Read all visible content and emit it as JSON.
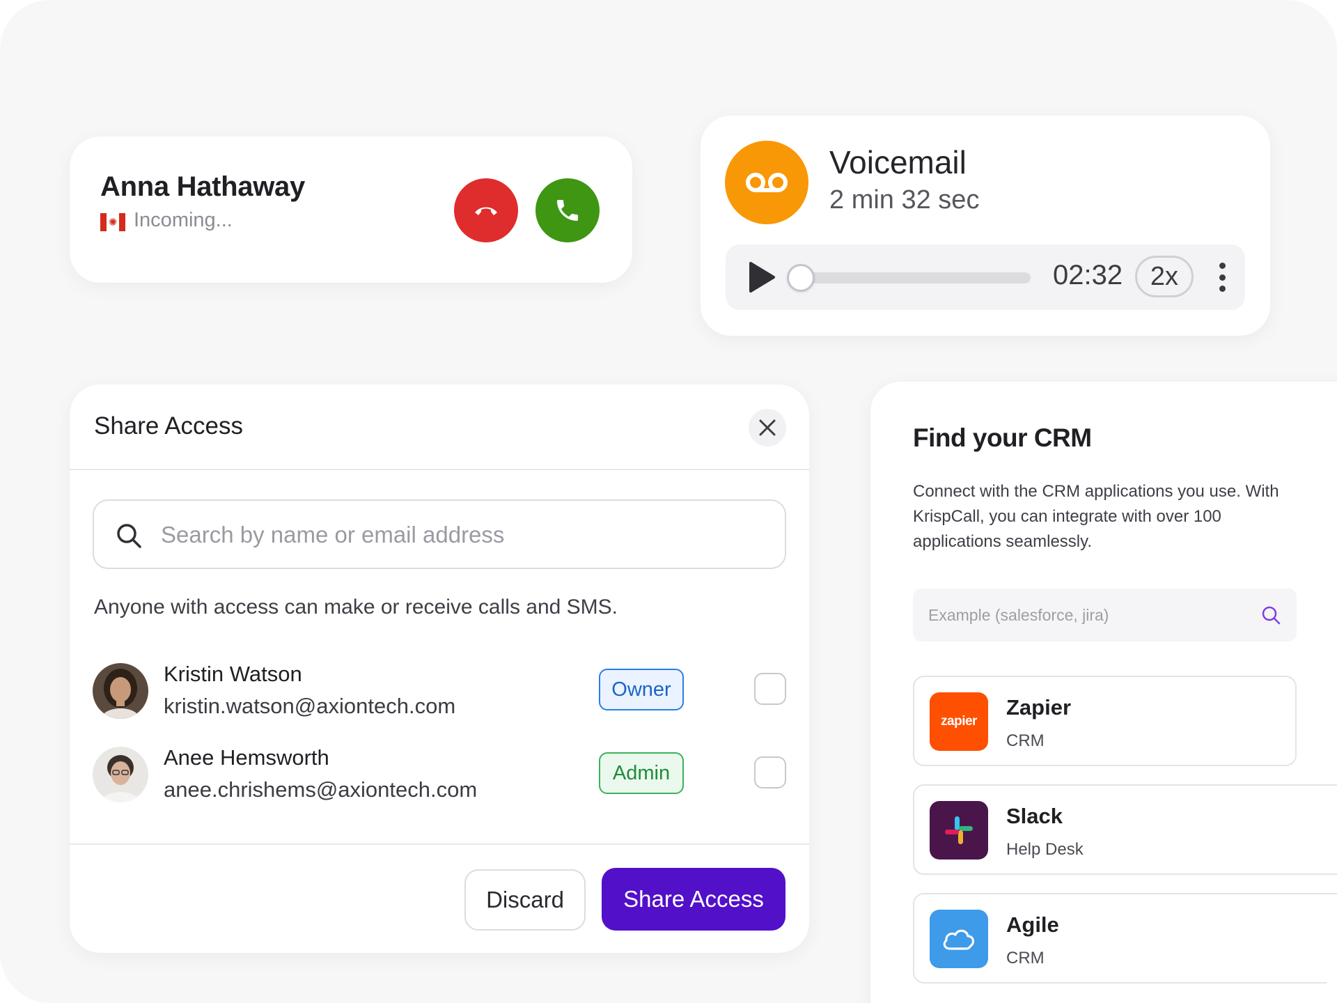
{
  "call": {
    "caller_name": "Anna Hathaway",
    "status": "Incoming...",
    "flag_icon": "canada-flag-icon",
    "decline_color": "#df2c2c",
    "accept_color": "#3e9612"
  },
  "voicemail": {
    "title": "Voicemail",
    "duration": "2 min 32 sec",
    "time": "02:32",
    "speed": "2x",
    "progress": 0,
    "accent": "#f99806"
  },
  "share": {
    "title": "Share Access",
    "search_placeholder": "Search by name or email address",
    "notice": "Anyone with access can make or receive calls and SMS.",
    "members": [
      {
        "name": "Kristin Watson",
        "email": "kristin.watson@axiontech.com",
        "role": "Owner",
        "checked": false
      },
      {
        "name": "Anee Hemsworth",
        "email": "anee.chrishems@axiontech.com",
        "role": "Admin",
        "checked": false
      }
    ],
    "discard_label": "Discard",
    "share_label": "Share Access",
    "primary_color": "#5210c9"
  },
  "crm": {
    "title": "Find your CRM",
    "description": "Connect with the CRM applications you use. With KrispCall, you can integrate with over 100 applications seamlessly.",
    "search_placeholder": "Example (salesforce, jira)",
    "items": [
      {
        "name": "Zapier",
        "category": "CRM",
        "logo_text": "zapier",
        "color": "#ff4f00"
      },
      {
        "name": "Slack",
        "category": "Help Desk",
        "color": "#4a154b"
      },
      {
        "name": "Agile",
        "category": "CRM",
        "color": "#3d9be9"
      }
    ]
  }
}
